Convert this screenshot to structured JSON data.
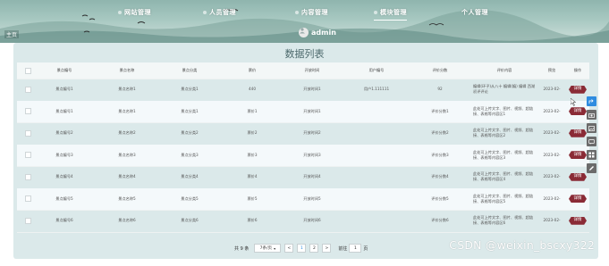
{
  "nav": {
    "items": [
      {
        "label": "网站管理"
      },
      {
        "label": "人员管理"
      },
      {
        "label": "内容管理"
      },
      {
        "label": "模块管理"
      },
      {
        "label": "个人管理"
      }
    ],
    "active_index": 3
  },
  "header": {
    "home_label": "主页",
    "user_name": "admin"
  },
  "page_title": "数据列表",
  "table": {
    "headers": [
      "景点编号",
      "景点名称",
      "景点分类",
      "票价",
      "开放时间",
      "用户编号",
      "评价分数",
      "评价内容",
      "预览",
      "操作"
    ],
    "rows": [
      {
        "c": [
          "景点编号1",
          "景点名称1",
          "景点分类1",
          "440",
          "开放时间1",
          "用户1.111111",
          "92",
          "编辑(环子)从八十 编辑(编) 编辑 西湖初评评论"
        ],
        "preview": "2023-02-",
        "action": "详情"
      },
      {
        "c": [
          "景点编号1",
          "景点名称1",
          "景点分类1",
          "票价1",
          "开放时间1",
          "",
          "评价分数1",
          "此处可上传文字、图片、视频、超链接、表格等内容区1"
        ],
        "preview": "2023-02-",
        "action": "详情"
      },
      {
        "c": [
          "景点编号2",
          "景点名称2",
          "景点分类2",
          "票价2",
          "开放时间2",
          "",
          "评价分数2",
          "此处可上传文字、图片、视频、超链接、表格等内容区2"
        ],
        "preview": "2023-02-",
        "action": "详情"
      },
      {
        "c": [
          "景点编号3",
          "景点名称3",
          "景点分类3",
          "票价3",
          "开放时间3",
          "",
          "评价分数3",
          "此处可上传文字、图片、视频、超链接、表格等内容区3"
        ],
        "preview": "2023-02-",
        "action": "详情"
      },
      {
        "c": [
          "景点编号4",
          "景点名称4",
          "景点分类4",
          "票价4",
          "开放时间4",
          "",
          "评价分数4",
          "此处可上传文字、图片、视频、超链接、表格等内容区4"
        ],
        "preview": "2023-02-",
        "action": "详情"
      },
      {
        "c": [
          "景点编号5",
          "景点名称5",
          "景点分类5",
          "票价5",
          "开放时间5",
          "",
          "评价分数5",
          "此处可上传文字、图片、视频、超链接、表格等内容区5"
        ],
        "preview": "2023-02-",
        "action": "详情"
      },
      {
        "c": [
          "景点编号6",
          "景点名称6",
          "景点分类6",
          "票价6",
          "开放时间6",
          "",
          "评价分数6",
          "此处可上传文字、图片、视频、超链接、表格等内容区6"
        ],
        "preview": "2023-02-",
        "action": "详情"
      }
    ]
  },
  "pagination": {
    "total_label": "共 9 条",
    "page_size": "7条/页",
    "prev": "<",
    "pages": [
      "1",
      "2"
    ],
    "next": ">",
    "goto_label": "前往",
    "goto_value": "1",
    "page_suffix": "页"
  },
  "watermark": "CSDN @weixin_bscxy322",
  "side_tools": [
    "share-icon",
    "camera-icon",
    "image-icon",
    "chat-icon",
    "grid-icon",
    "edit-icon"
  ],
  "colors": {
    "accent": "#8a2b36",
    "panel": "#dbe9ea",
    "banner": "#a7c8c1",
    "link": "#2f8ce0"
  }
}
